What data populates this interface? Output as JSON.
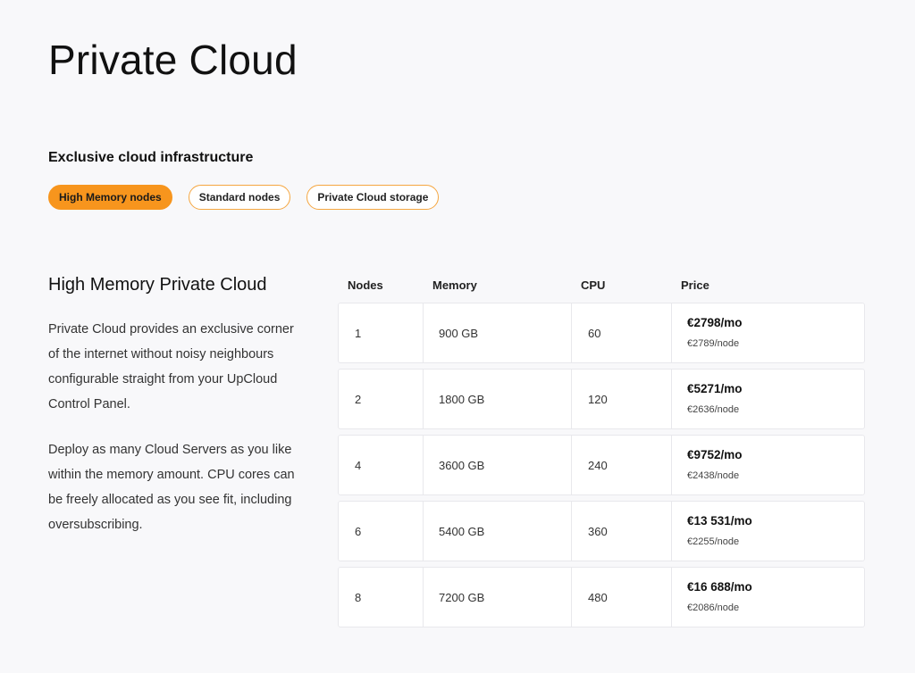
{
  "page": {
    "title": "Private Cloud",
    "subtitle": "Exclusive cloud infrastructure"
  },
  "tabs": [
    {
      "label": "High Memory nodes",
      "active": true
    },
    {
      "label": "Standard nodes",
      "active": false
    },
    {
      "label": "Private Cloud storage",
      "active": false
    }
  ],
  "section": {
    "title": "High Memory Private Cloud",
    "paragraph_1": "Private Cloud provides an exclusive corner of the internet without noisy neighbours configurable straight from your UpCloud Control Panel.",
    "paragraph_2": "Deploy as many Cloud Servers as you like within the memory amount. CPU cores can be freely allocated as you see fit, including oversubscribing."
  },
  "table": {
    "headers": {
      "nodes": "Nodes",
      "memory": "Memory",
      "cpu": "CPU",
      "price": "Price"
    },
    "rows": [
      {
        "nodes": "1",
        "memory": "900 GB",
        "cpu": "60",
        "price": "€2798/mo",
        "per_node": "€2789/node"
      },
      {
        "nodes": "2",
        "memory": "1800 GB",
        "cpu": "120",
        "price": "€5271/mo",
        "per_node": "€2636/node"
      },
      {
        "nodes": "4",
        "memory": "3600 GB",
        "cpu": "240",
        "price": "€9752/mo",
        "per_node": "€2438/node"
      },
      {
        "nodes": "6",
        "memory": "5400 GB",
        "cpu": "360",
        "price": "€13 531/mo",
        "per_node": "€2255/node"
      },
      {
        "nodes": "8",
        "memory": "7200 GB",
        "cpu": "480",
        "price": "€16 688/mo",
        "per_node": "€2086/node"
      }
    ]
  },
  "colors": {
    "accent": "#f7951d",
    "background": "#f8f8fa"
  }
}
